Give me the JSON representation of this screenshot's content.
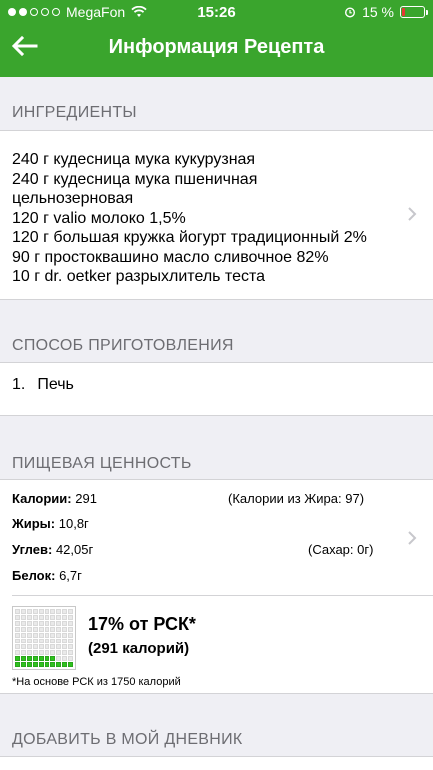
{
  "status_bar": {
    "carrier": "MegaFon",
    "time": "15:26",
    "battery_text": "15 %",
    "battery_level": 0.15
  },
  "header": {
    "title": "Информация Рецепта"
  },
  "ingredients": {
    "section_title": "ИНГРЕДИЕНТЫ",
    "lines": [
      "240 г кудесница мука кукурузная",
      "240 г кудесница мука пшеничная",
      "цельнозерновая",
      "120 г valio молоко 1,5%",
      "120 г большая кружка йогурт традиционный 2%",
      "90 г простоквашино масло сливочное 82%",
      "10 г dr. oetker разрыхлитель теста"
    ]
  },
  "method": {
    "section_title": "СПОСОБ ПРИГОТОВЛЕНИЯ",
    "steps": [
      {
        "num": "1.",
        "text": "Печь"
      }
    ]
  },
  "nutrition": {
    "section_title": "ПИЩЕВАЯ ЦЕННОСТЬ",
    "calories_label": "Калории:",
    "calories_value": "291",
    "fat_calories_text": "(Калории из Жира: 97)",
    "fat_label": "Жиры:",
    "fat_value": "10,8г",
    "carbs_label": "Углев:",
    "carbs_value": "42,05г",
    "sugar_text": "(Сахар: 0г)",
    "protein_label": "Белок:",
    "protein_value": "6,7г",
    "rsk_percent": 17,
    "rsk_title": "17% от РСК*",
    "rsk_sub": "(291 калорий)",
    "rsk_note": "*На основе РСК из 1750 калорий"
  },
  "diary": {
    "section_title": "ДОБАВИТЬ В МОЙ ДНЕВНИК"
  },
  "colors": {
    "header_green": "#3aa52d",
    "bar_green": "#2ec21e",
    "battery_red": "#e53935"
  }
}
